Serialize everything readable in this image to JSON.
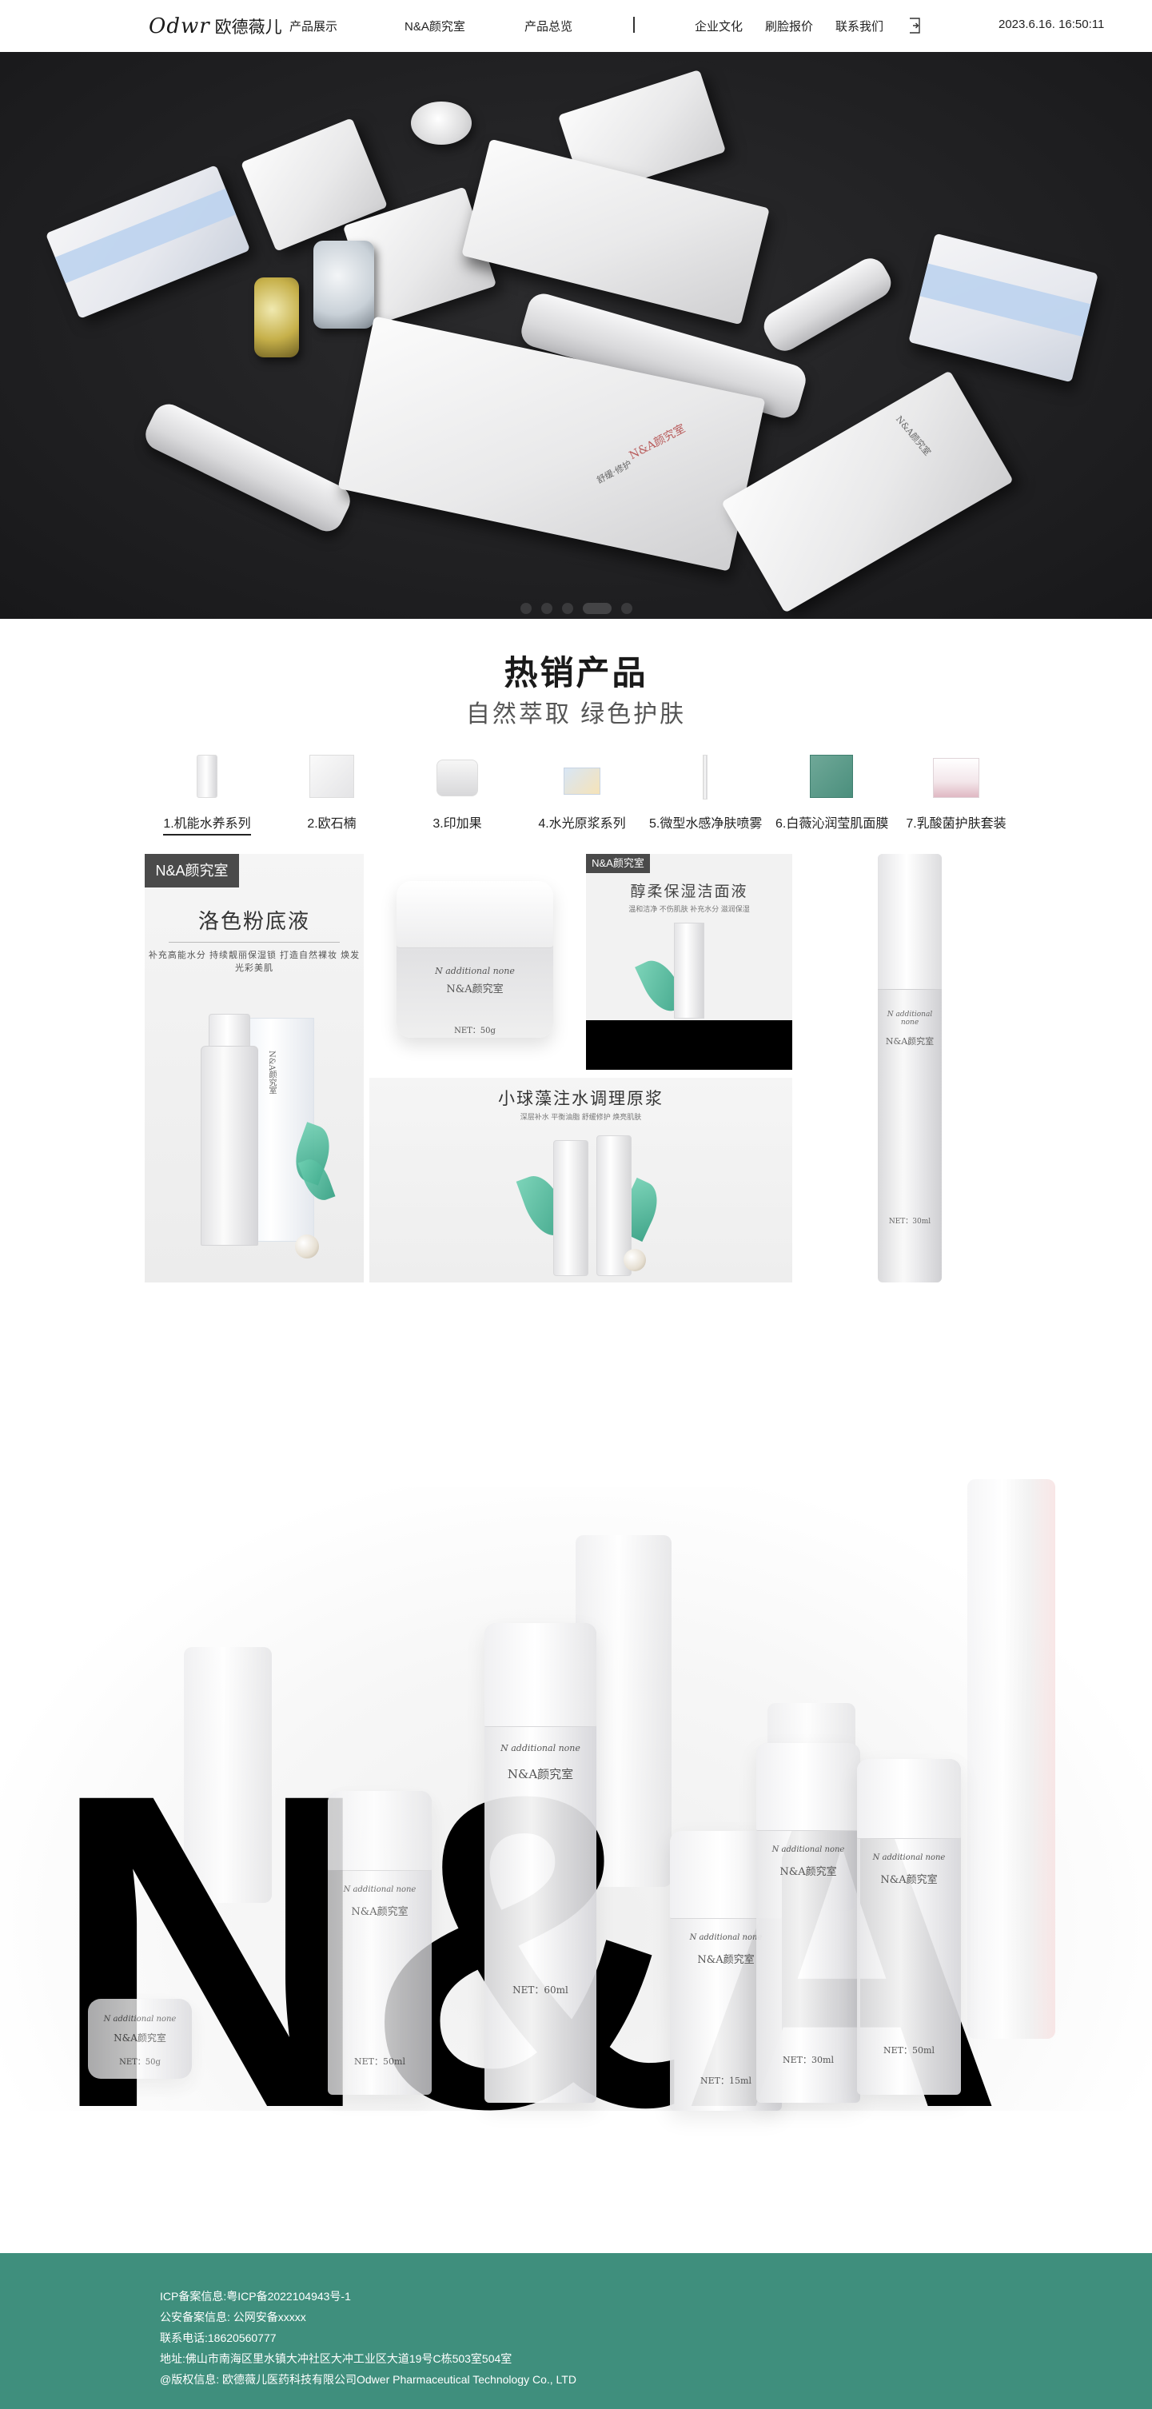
{
  "header": {
    "logo_script": "Odwr",
    "logo_cn": "欧德薇儿",
    "nav": [
      {
        "label": "产品展示"
      },
      {
        "label": "N&A颜究室"
      },
      {
        "label": "产品总览"
      },
      {
        "label": "企业文化"
      },
      {
        "label": "刷脸报价"
      },
      {
        "label": "联系我们"
      }
    ],
    "datetime": "2023.6.16. 16:50:11"
  },
  "banner": {
    "slides": 5,
    "active_slide": 4,
    "book_title": "N&A颜究室",
    "book_sub": "舒缓·修护",
    "bottle_label": "N&A颜究室"
  },
  "hot": {
    "title": "热销产品",
    "subtitle": "自然萃取 绿色护肤",
    "categories": [
      {
        "label": "1.机能水养系列",
        "thumb": "bottle"
      },
      {
        "label": "2.欧石楠",
        "thumb": "box"
      },
      {
        "label": "3.印加果",
        "thumb": "jar"
      },
      {
        "label": "4.水光原浆系列",
        "thumb": "bluebox"
      },
      {
        "label": "5.微型水感净肤喷雾",
        "thumb": "slim"
      },
      {
        "label": "6.白薇沁润莹肌面膜",
        "thumb": "green"
      },
      {
        "label": "7.乳酸菌护肤套装",
        "thumb": "pinkbox"
      }
    ],
    "active_category": 0
  },
  "gallery": {
    "card1": {
      "tag": "N&A颜究室",
      "title": "洛色粉底液",
      "sub": "补充高能水分  持续靓丽保湿锁  打造自然裸妆  焕发光彩美肌",
      "box_label": "N&A颜究室"
    },
    "card2": {
      "line1": "N additional none",
      "line2": "N&A颜究室",
      "line3": "NET：50g"
    },
    "card3": {
      "tag": "N&A颜究室",
      "title": "醇柔保湿洁面液",
      "sub": "温和洁净  不伤肌肤  补充水分  滋润保湿"
    },
    "card4": {
      "line1": "N additional none",
      "line2": "N&A颜究室",
      "line3": "NET：30ml"
    },
    "card5": {
      "title": "小球藻注水调理原浆",
      "sub": "深层补水  平衡油脂  舒缓修护  焕亮肌肤"
    }
  },
  "na_section": {
    "big_text": "N&A",
    "products": [
      {
        "line1": "N additional none",
        "line2": "N&A颜究室",
        "line3": "NET：60ml"
      },
      {
        "line1": "N additional none",
        "line2": "N&A颜究室",
        "line3": "NET：15ml"
      },
      {
        "line1": "N additional none",
        "line2": "N&A颜究室",
        "line3": "NET：30ml"
      },
      {
        "line1": "N additional none",
        "line2": "N&A颜究室",
        "line3": "NET：50ml"
      },
      {
        "line1": "N additional none",
        "line2": "N&A颜究室",
        "line3": "NET：50g"
      },
      {
        "line1": "N additional none",
        "line2": "N&A颜究室",
        "line3": "NET：50ml"
      }
    ]
  },
  "footer": {
    "lines": [
      "ICP备案信息:粤ICP备2022104943号-1",
      "公安备案信息: 公网安备xxxxx",
      "联系电话:18620560777",
      "地址:佛山市南海区里水镇大冲社区大冲工业区大道19号C栋503室504室",
      "@版权信息: 欧德薇儿医药科技有限公司Odwer Pharmaceutical Technology Co., LTD"
    ],
    "bg_color": "#3f8f7d"
  }
}
